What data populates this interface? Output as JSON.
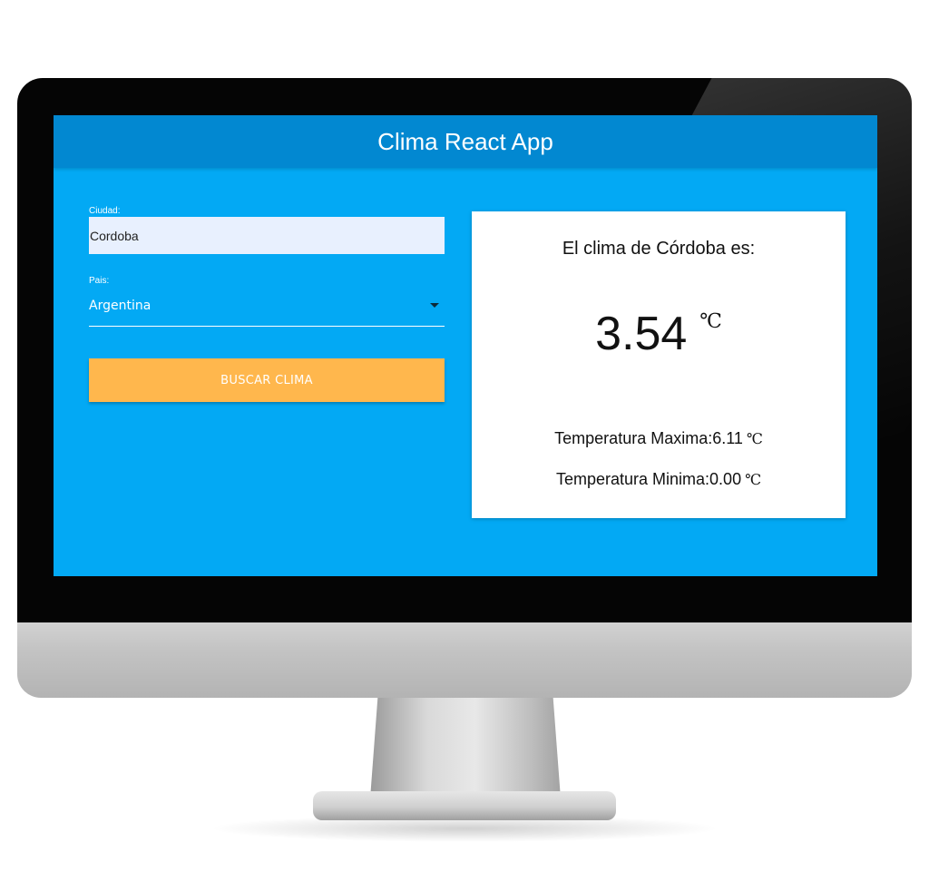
{
  "app": {
    "title": "Clima React App"
  },
  "form": {
    "city_label": "Ciudad:",
    "city_value": "Cordoba",
    "country_label": "Pais:",
    "country_value": "Argentina",
    "submit_label": "BUSCAR CLIMA"
  },
  "result": {
    "heading": "El clima de Córdoba es:",
    "temperature": "3.54",
    "unit": "℃",
    "max_label": "Temperatura Maxima:",
    "max_value": "6.11",
    "min_label": "Temperatura Minima:",
    "min_value": "0.00"
  },
  "colors": {
    "header": "#0288d1",
    "background": "#03a9f4",
    "button": "#ffb74d",
    "card": "#ffffff",
    "input_fill": "#e8f0fe"
  },
  "icons": {
    "select_arrow": "chevron-down-icon"
  }
}
